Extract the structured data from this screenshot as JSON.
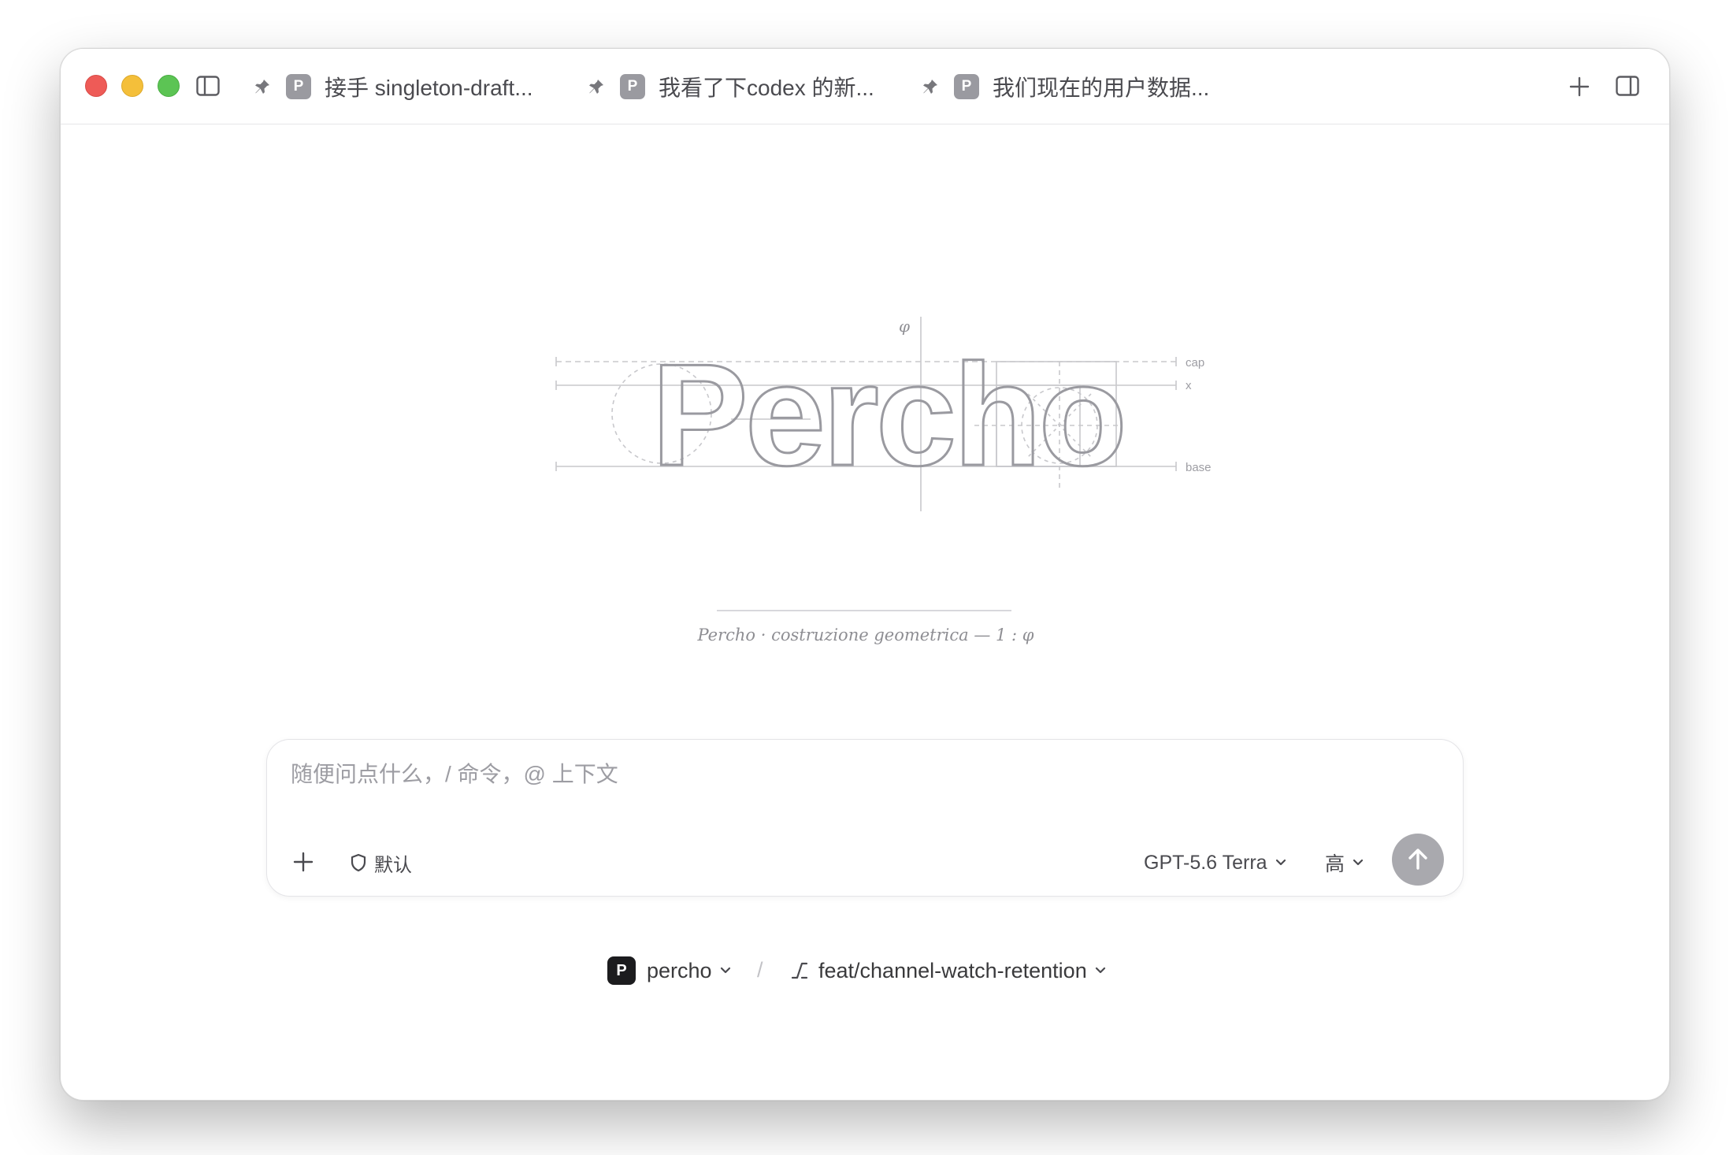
{
  "tabs": [
    {
      "label": "接手 singleton-draft...",
      "badge": "P"
    },
    {
      "label": "我看了下codex 的新...",
      "badge": "P"
    },
    {
      "label": "我们现在的用户数据...",
      "badge": "P"
    }
  ],
  "logo": {
    "wordmark": "Percho",
    "phi": "φ",
    "guide_cap": "cap",
    "guide_x": "x",
    "guide_base": "base"
  },
  "caption": "Percho · costruzione geometrica — 1 : φ",
  "composer": {
    "placeholder": "随便问点什么，/ 命令，@ 上下文",
    "mode_label": "默认",
    "model_label": "GPT-5.6 Terra",
    "effort_label": "高"
  },
  "footer": {
    "project_badge": "P",
    "project_name": "percho",
    "separator": "/",
    "branch_name": "feat/channel-watch-retention"
  },
  "colors": {
    "close": "#ee5b57",
    "minimize": "#f4bf3a",
    "maximize": "#5cc454",
    "send_button": "#a9a9ae",
    "logo_stroke": "#9a9aa0",
    "guide_stroke": "#c8c8cc"
  },
  "icons": [
    "sidebar-icon",
    "pin-icon",
    "plus-icon",
    "panel-icon",
    "shield-icon",
    "chevron-down-icon",
    "arrow-up-icon",
    "branch-icon"
  ]
}
